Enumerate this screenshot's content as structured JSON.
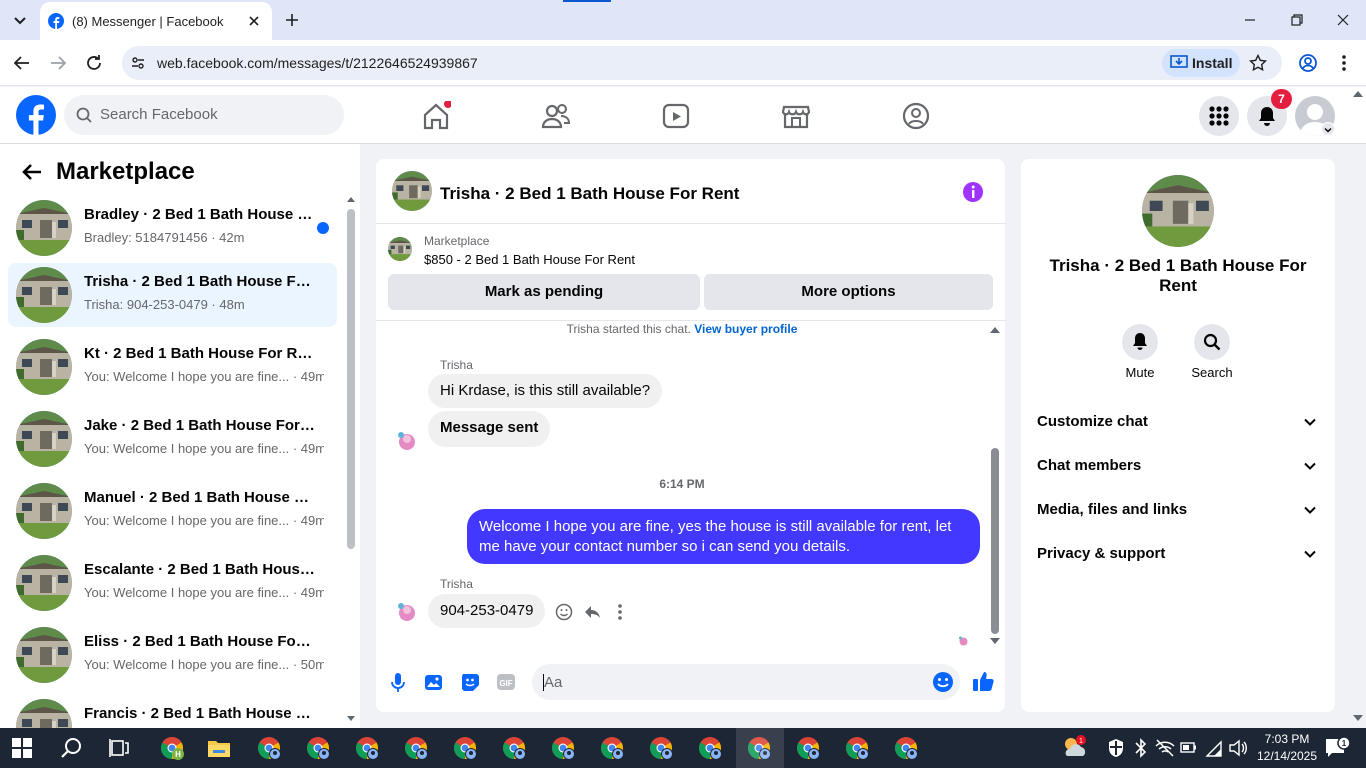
{
  "browser": {
    "tab_title": "(8) Messenger | Facebook",
    "url": "web.facebook.com/messages/t/2122646524939867",
    "install_label": "Install"
  },
  "fb": {
    "search_placeholder": "Search Facebook",
    "notification_count": "7"
  },
  "sidebar": {
    "title": "Marketplace",
    "conversations": [
      {
        "name": "Bradley · 2 Bed 1 Bath House F...",
        "preview": "Bradley: 5184791456 · 42m",
        "unread": true
      },
      {
        "name": "Trisha · 2 Bed 1 Bath House For ...",
        "preview": "Trisha: 904-253-0479 · 48m",
        "selected": true
      },
      {
        "name": "Kt · 2 Bed 1 Bath House For Rent",
        "preview": "You: Welcome I hope you are fine... · 49m"
      },
      {
        "name": "Jake · 2 Bed 1 Bath House For Re...",
        "preview": "You: Welcome I hope you are fine... · 49m"
      },
      {
        "name": "Manuel · 2 Bed 1 Bath House For...",
        "preview": "You: Welcome I hope you are fine... · 49m"
      },
      {
        "name": "Escalante · 2 Bed 1 Bath House F...",
        "preview": "You: Welcome I hope you are fine... · 49m"
      },
      {
        "name": "Eliss · 2 Bed 1 Bath House For Rent",
        "preview": "You: Welcome I hope you are fine... · 50m"
      },
      {
        "name": "Francis · 2 Bed 1 Bath House For ...",
        "preview": ""
      }
    ]
  },
  "chat": {
    "title": "Trisha · 2 Bed 1 Bath House For Rent",
    "listing_source": "Marketplace",
    "listing_title": "$850 - 2 Bed 1 Bath House For Rent",
    "mark_pending_label": "Mark as pending",
    "more_options_label": "More options",
    "started_text": "Trisha started this chat.",
    "view_profile_label": "View buyer profile",
    "sender_name_1": "Trisha",
    "msg_1": "Hi Krdase, is this still available?",
    "msg_2": "Message sent",
    "timestamp": "6:14 PM",
    "msg_3_line1": "Welcome I hope you are fine, yes the house is still available for rent, let",
    "msg_3_line2": "me have your contact number so i can send you  details.",
    "sender_name_2": "Trisha",
    "msg_4": "904-253-0479",
    "composer_placeholder": "Aa"
  },
  "info": {
    "title_line1": "Trisha · 2 Bed 1 Bath House For",
    "title_line2": "Rent",
    "mute_label": "Mute",
    "search_label": "Search",
    "sections": [
      "Customize chat",
      "Chat members",
      "Media, files and links",
      "Privacy & support"
    ]
  },
  "taskbar": {
    "time": "7:03 PM",
    "date": "12/14/2025",
    "notif_count": "1"
  },
  "colors": {
    "fb_blue": "#0866ff",
    "own_bubble": "#4338ff",
    "selected_row": "#ebf5ff",
    "messenger_purple": "#a033ff"
  }
}
